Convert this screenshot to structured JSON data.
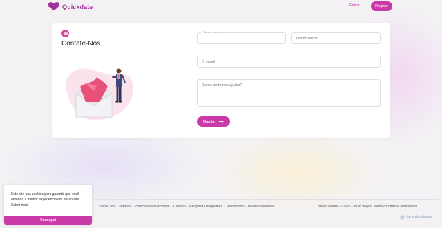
{
  "header": {
    "brand": "Quickdate",
    "login_label": "Entrar",
    "register_label": "Registo"
  },
  "contact": {
    "title": "Contate-Nos",
    "first_name_label": "Primeiro nome",
    "last_name_placeholder": "Último nome",
    "email_placeholder": "O email",
    "message_placeholder": "Como podemos ajudar?",
    "send_label": "Mandar"
  },
  "footer": {
    "links": [
      "Sobre nós",
      "Termos",
      "Política de Privacidade",
      "Contato",
      "Perguntas frequentes",
      "Reembolso",
      "Desenvolvedores"
    ],
    "copyright": "direito autoral © 2026 Crush Vegas. Todos os direitos reservados."
  },
  "cookie": {
    "text": "Este site usa cookies para garantir que você obtenha a melhor experiência em nosso site.",
    "link_label": "Saber mais",
    "button_label": "Conseguí"
  },
  "watermark": "ScanMalware",
  "colors": {
    "accent": "#c93aa8",
    "brand": "#a0329b"
  }
}
